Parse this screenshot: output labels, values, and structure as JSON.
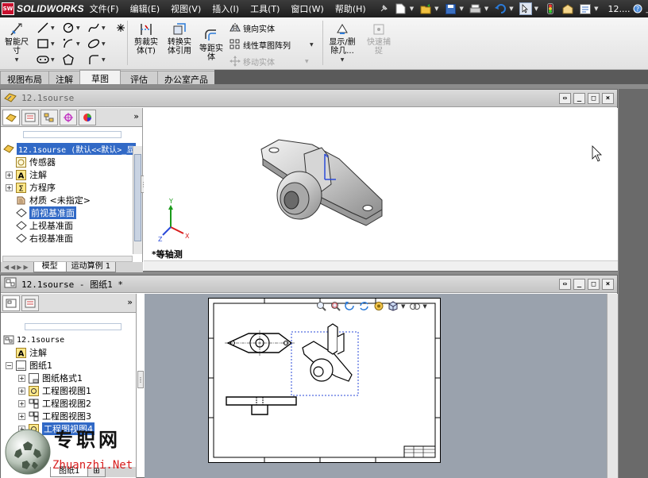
{
  "app": {
    "logo_badge": "SW",
    "logo_name": "SOLIDWORKS",
    "title_doc": "12...."
  },
  "menus": [
    "文件(F)",
    "编辑(E)",
    "视图(V)",
    "插入(I)",
    "工具(T)",
    "窗口(W)",
    "帮助(H)"
  ],
  "command": {
    "smart_dim": "智能尺\n寸",
    "trim": "剪裁实\n体(T)",
    "convert": "转换实\n体引用",
    "offset": "等距实\n体",
    "mirror": "镜向实体",
    "linear_pattern": "线性草图阵列",
    "move": "移动实体",
    "display_delete": "显示/删\n除几...",
    "quick_snap": "快速捕\n捉"
  },
  "tabs": [
    "视图布局",
    "注解",
    "草图",
    "评估",
    "办公室产品"
  ],
  "active_tab": "草图",
  "part_window": {
    "title": "12.1sourse",
    "tree": {
      "root": "12.1sourse  (默认<<默认>_显",
      "items": [
        "传感器",
        "注解",
        "方程序",
        "材质 <未指定>",
        "前视基准面",
        "上视基准面",
        "右视基准面"
      ]
    },
    "bottom_tabs": [
      "模型",
      "运动算例 1"
    ],
    "view_label": "*等轴测"
  },
  "drawing_window": {
    "title": "12.1sourse - 图纸1 *",
    "tree": {
      "root": "12.1sourse",
      "items": [
        "注解",
        "图纸1",
        "图纸格式1",
        "工程图视图1",
        "工程图视图2",
        "工程图视图3",
        "工程图视图4"
      ]
    },
    "bottom_tab": "图纸1"
  },
  "watermark": {
    "brand": "专职网",
    "url": "Zhuanzhi.Net"
  },
  "colors": {
    "selection": "#3169c6",
    "menubar": "#2a2a2a",
    "sw_red": "#c8102e",
    "watermark_url": "#d81e1e"
  }
}
